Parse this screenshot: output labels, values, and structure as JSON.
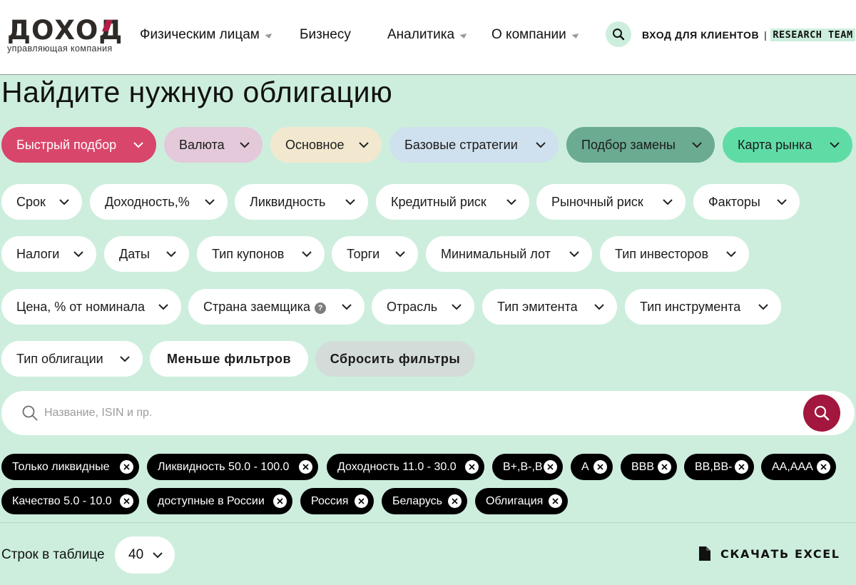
{
  "header": {
    "logo_text": "ДОХОД",
    "logo_subtitle": "управляющая компания",
    "nav": [
      {
        "label": "Физическим лицам",
        "dropdown": true
      },
      {
        "label": "Бизнесу",
        "dropdown": false
      },
      {
        "label": "Аналитика",
        "dropdown": true
      },
      {
        "label": "О компании",
        "dropdown": true
      }
    ],
    "login_label": "ВХОД ДЛЯ КЛИЕНТОВ",
    "separator": "|",
    "research_label": "RESEARCH TEAM",
    "accent_color": "#b31e48"
  },
  "page_title": "Найдите нужную облигацию",
  "preset_tabs": [
    {
      "label": "Быстрый подбор",
      "bg": "#d9466b",
      "fg": "#ffffff"
    },
    {
      "label": "Валюта",
      "bg": "#e3c9d9",
      "fg": "#1b1b1b"
    },
    {
      "label": "Основное",
      "bg": "#f2e8cf",
      "fg": "#1b1b1b"
    },
    {
      "label": "Базовые стратегии",
      "bg": "#cfe0ee",
      "fg": "#1b1b1b"
    },
    {
      "label": "Подбор замены",
      "bg": "#6aab92",
      "fg": "#1b1b1b"
    },
    {
      "label": "Карта рынка",
      "bg": "#5fdca6",
      "fg": "#1b1b1b"
    }
  ],
  "filters": {
    "row1": [
      "Срок",
      "Доходность,%",
      "Ликвидность",
      "Кредитный риск",
      "Рыночный риск",
      "Факторы"
    ],
    "row2": [
      "Налоги",
      "Даты",
      "Тип купонов",
      "Торги",
      "Минимальный лот",
      "Тип инвесторов"
    ],
    "row3": [
      "Цена, % от номинала",
      "Страна заемщика",
      "Отрасль",
      "Тип эмитента",
      "Тип инструмента"
    ],
    "row4": [
      "Тип облигации"
    ],
    "help_mark": "?",
    "less_filters": "Меньше фильтров",
    "reset_filters": "Сбросить фильтры"
  },
  "search": {
    "placeholder": "Название, ISIN и пр.",
    "button_color": "#a3163d"
  },
  "active_chips": [
    "Только ликвидные",
    "Ликвидность 50.0 - 100.0",
    "Доходность 11.0 - 30.0",
    "B+,B-,B",
    "A",
    "BBB",
    "BB,BB-",
    "AA,AAA",
    "Качество 5.0 - 10.0",
    "доступные в России",
    "Россия",
    "Беларусь",
    "Облигация"
  ],
  "table_controls": {
    "rows_label": "Строк в таблице",
    "rows_value": "40",
    "excel_label": "СКАЧАТЬ EXCEL"
  }
}
